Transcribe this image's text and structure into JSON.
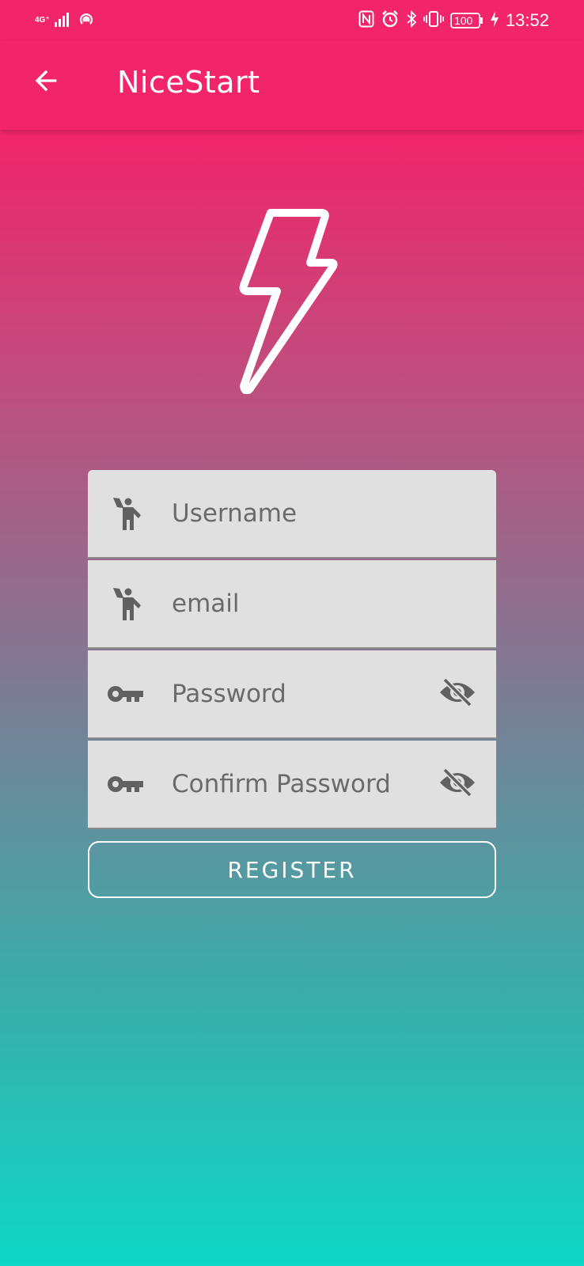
{
  "status_bar": {
    "network_label": "4G⁺",
    "time": "13:52",
    "battery": "100",
    "icons": [
      "signal-icon",
      "hotspot-icon",
      "nfc-icon",
      "alarm-icon",
      "bluetooth-icon",
      "vibrate-icon",
      "battery-icon",
      "charging-icon"
    ]
  },
  "app_bar": {
    "title": "NiceStart",
    "back_icon": "arrow-back-icon",
    "background": "#f2256a"
  },
  "logo": {
    "icon": "lightning-bolt-icon",
    "color": "#ffffff"
  },
  "form": {
    "fields": [
      {
        "placeholder": "Username",
        "value": "",
        "icon": "person-waving-icon"
      },
      {
        "placeholder": "email",
        "value": "",
        "icon": "person-waving-icon"
      },
      {
        "placeholder": "Password",
        "value": "",
        "icon": "key-icon",
        "trailing_icon": "visibility-off-icon"
      },
      {
        "placeholder": "Confirm Password",
        "value": "",
        "icon": "key-icon",
        "trailing_icon": "visibility-off-icon"
      }
    ],
    "field_background": "#e0e0e0",
    "icon_color": "#616161"
  },
  "register_button": {
    "label": "REGISTER"
  },
  "gradient": {
    "top": "#f2256a",
    "middle": "#7d7c94",
    "bottom": "#0ed7c5"
  }
}
